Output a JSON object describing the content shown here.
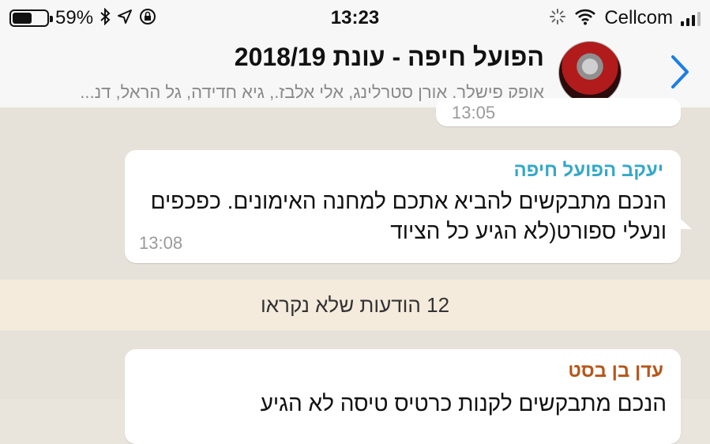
{
  "status_bar": {
    "battery_percent": "59%",
    "battery_level": 0.59,
    "time": "13:23",
    "carrier": "Cellcom"
  },
  "header": {
    "title": "הפועל חיפה - עונת 2018/19",
    "participants": "אופק פישלר, אורן סטרלינג, אלי אלבז., גיא חדידה, גל הראל, דנ..."
  },
  "messages": [
    {
      "timestamp": "13:05"
    },
    {
      "sender": "יעקב הפועל חיפה",
      "sender_color": "#35a8c7",
      "text": "הנכם מתבקשים להביא אתכם למחנה האימונים. כפכפים ונעלי ספורט(לא הגיע כל הציוד",
      "timestamp": "13:08"
    }
  ],
  "unread_banner": "12 הודעות שלא נקראו",
  "next_message": {
    "sender": "עדן בן בסט",
    "sender_color": "#b5561a",
    "text_partial": "הנכם מתבקשים לקנות כרטיס טיסה לא הגיע"
  },
  "colors": {
    "accent_blue": "#1a7ee6",
    "bar_background": "#f7f7f7",
    "chat_background": "#e7e2d9"
  }
}
